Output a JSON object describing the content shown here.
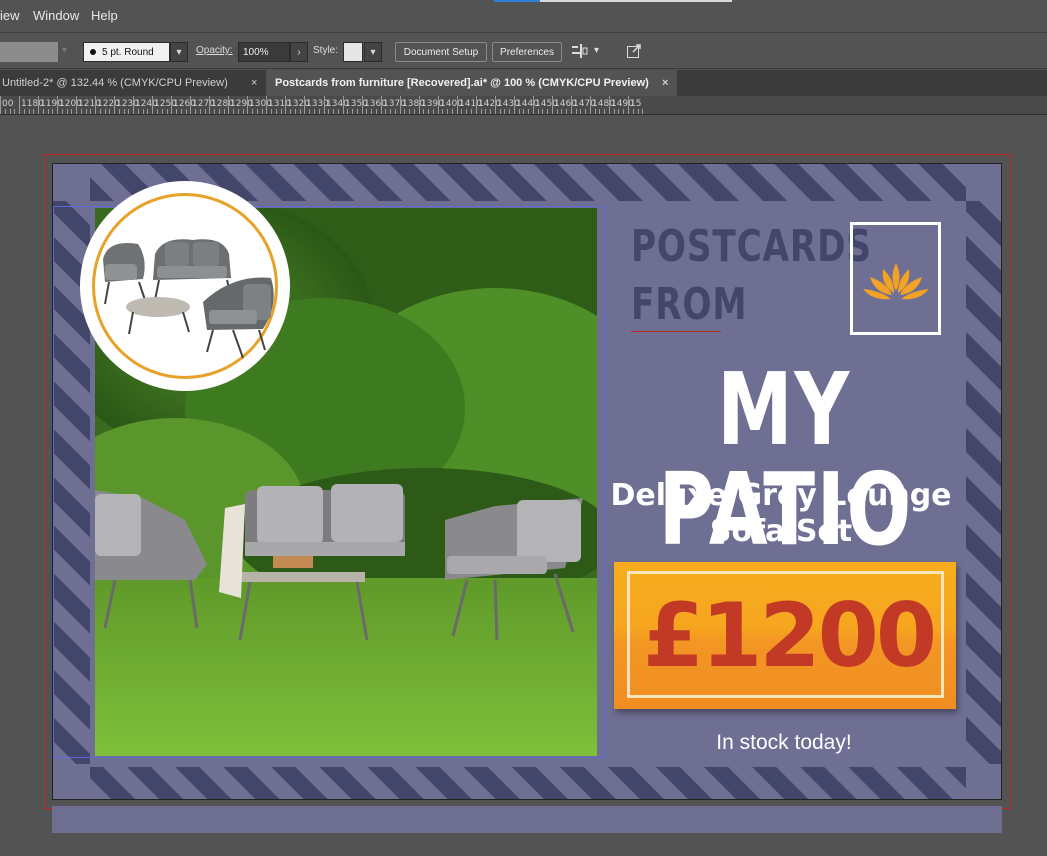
{
  "menubar": {
    "items": [
      "iew",
      "Window",
      "Help"
    ]
  },
  "controlbar": {
    "stroke_profile": "5 pt. Round",
    "opacity_label": "Opacity:",
    "opacity_value": "100%",
    "style_label": "Style:",
    "document_setup": "Document Setup",
    "preferences": "Preferences",
    "chevron": "▾",
    "arrow_right": "›"
  },
  "tabs": [
    {
      "label": "Untitled-2* @ 132.44 % (CMYK/CPU Preview)",
      "close": "×",
      "active": false
    },
    {
      "label": "Postcards from furniture [Recovered].ai* @ 100 % (CMYK/CPU Preview)",
      "close": "×",
      "active": true
    }
  ],
  "ruler": {
    "labels": [
      "00",
      "1180",
      "1190",
      "1200",
      "1210",
      "1220",
      "1230",
      "1240",
      "1250",
      "1260",
      "1270",
      "1280",
      "1290",
      "1300",
      "1310",
      "1320",
      "1330",
      "1340",
      "1350",
      "1360",
      "1370",
      "1380",
      "1390",
      "1400",
      "1410",
      "1420",
      "1430",
      "1440",
      "1450",
      "1460",
      "1470",
      "1480",
      "1490",
      "15"
    ]
  },
  "postcard": {
    "heading_line1": "POSTCARDS",
    "heading_line2": "FROM",
    "title": "MY PATIO",
    "subtitle_line1": "Deluxe Grey Lounge",
    "subtitle_line2": "Sofa Set",
    "price": "£1200",
    "stock": "In stock today!"
  },
  "colors": {
    "card_bg": "#6f6f94",
    "stripe_dark": "#43466b",
    "heading": "#43466b",
    "price_text": "#c23a25",
    "price_box": "#f6a51f",
    "ring": "#e8a22a",
    "lotus": "#f2a227"
  },
  "icons": {
    "logo": "lotus-icon",
    "align": "align-icon",
    "export": "export-icon"
  }
}
